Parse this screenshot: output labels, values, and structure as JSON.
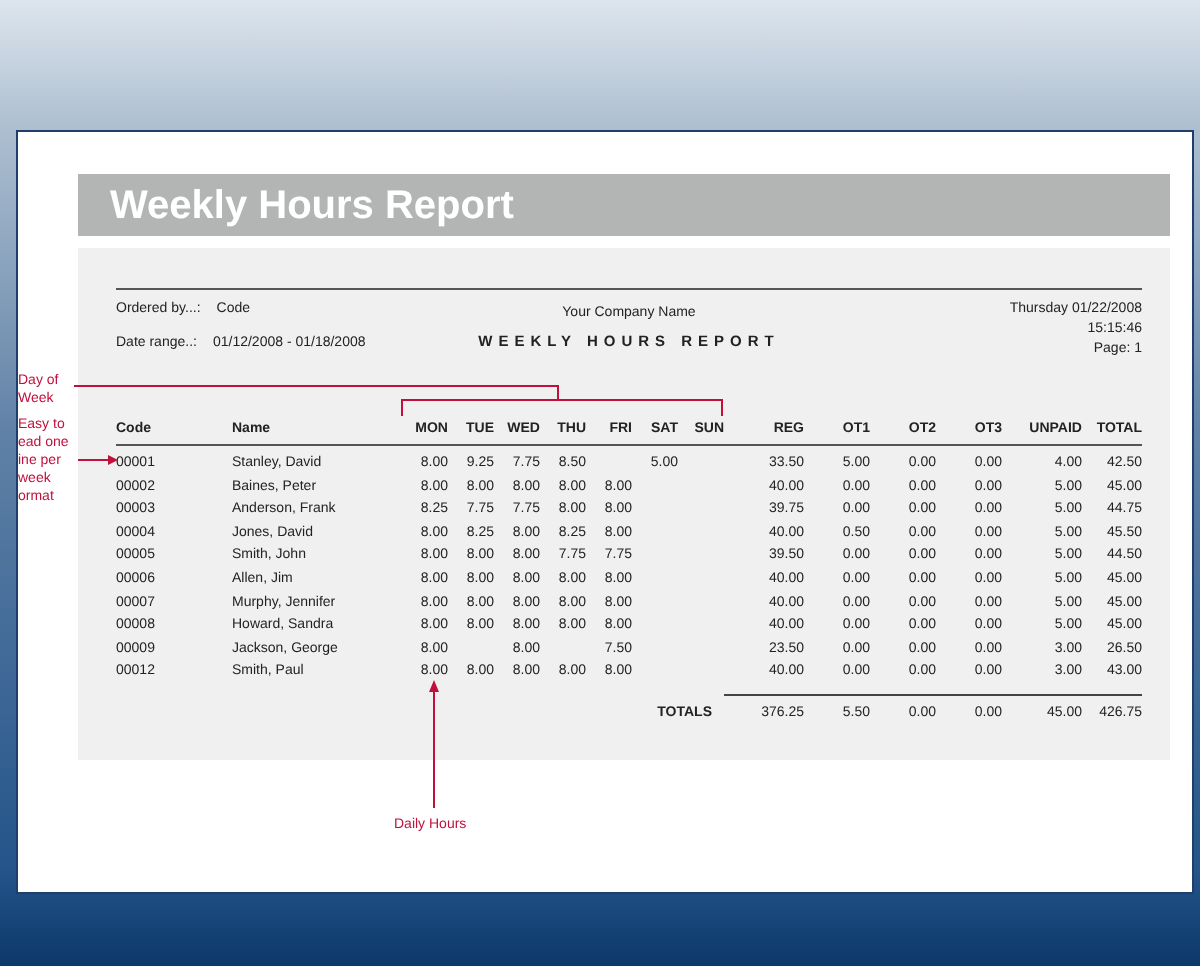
{
  "report": {
    "title": "Weekly Hours Report",
    "ordered_by": {
      "label": "Ordered by...:",
      "value": "Code"
    },
    "date_range": {
      "label": "Date range..:",
      "value": "01/12/2008 - 01/18/2008"
    },
    "company": "Your Company Name",
    "heading": "WEEKLY HOURS REPORT",
    "date": "Thursday  01/22/2008",
    "time": "15:15:46",
    "page": "Page: 1",
    "columns": [
      "Code",
      "Name",
      "MON",
      "TUE",
      "WED",
      "THU",
      "FRI",
      "SAT",
      "SUN",
      "REG",
      "OT1",
      "OT2",
      "OT3",
      "UNPAID",
      "TOTAL"
    ],
    "rows": [
      [
        "00001",
        "Stanley, David",
        "8.00",
        "9.25",
        "7.75",
        "8.50",
        null,
        "5.00",
        null,
        "33.50",
        "5.00",
        "0.00",
        "0.00",
        "4.00",
        "42.50"
      ],
      [
        "00002",
        "Baines, Peter",
        "8.00",
        "8.00",
        "8.00",
        "8.00",
        "8.00",
        null,
        null,
        "40.00",
        "0.00",
        "0.00",
        "0.00",
        "5.00",
        "45.00"
      ],
      [
        "00003",
        "Anderson, Frank",
        "8.25",
        "7.75",
        "7.75",
        "8.00",
        "8.00",
        null,
        null,
        "39.75",
        "0.00",
        "0.00",
        "0.00",
        "5.00",
        "44.75"
      ],
      [
        "00004",
        "Jones, David",
        "8.00",
        "8.25",
        "8.00",
        "8.25",
        "8.00",
        null,
        null,
        "40.00",
        "0.50",
        "0.00",
        "0.00",
        "5.00",
        "45.50"
      ],
      [
        "00005",
        "Smith, John",
        "8.00",
        "8.00",
        "8.00",
        "7.75",
        "7.75",
        null,
        null,
        "39.50",
        "0.00",
        "0.00",
        "0.00",
        "5.00",
        "44.50"
      ],
      [
        "00006",
        "Allen, Jim",
        "8.00",
        "8.00",
        "8.00",
        "8.00",
        "8.00",
        null,
        null,
        "40.00",
        "0.00",
        "0.00",
        "0.00",
        "5.00",
        "45.00"
      ],
      [
        "00007",
        "Murphy, Jennifer",
        "8.00",
        "8.00",
        "8.00",
        "8.00",
        "8.00",
        null,
        null,
        "40.00",
        "0.00",
        "0.00",
        "0.00",
        "5.00",
        "45.00"
      ],
      [
        "00008",
        "Howard, Sandra",
        "8.00",
        "8.00",
        "8.00",
        "8.00",
        "8.00",
        null,
        null,
        "40.00",
        "0.00",
        "0.00",
        "0.00",
        "5.00",
        "45.00"
      ],
      [
        "00009",
        "Jackson, George",
        "8.00",
        null,
        "8.00",
        null,
        "7.50",
        null,
        null,
        "23.50",
        "0.00",
        "0.00",
        "0.00",
        "3.00",
        "26.50"
      ],
      [
        "00012",
        "Smith, Paul",
        "8.00",
        "8.00",
        "8.00",
        "8.00",
        "8.00",
        null,
        null,
        "40.00",
        "0.00",
        "0.00",
        "0.00",
        "3.00",
        "43.00"
      ]
    ],
    "totals": {
      "label": "TOTALS",
      "values": [
        "376.25",
        "5.50",
        "0.00",
        "0.00",
        "45.00",
        "426.75"
      ]
    }
  },
  "annotations": [
    {
      "kind": "bracket",
      "lines": [
        "Day of",
        "Week"
      ]
    },
    {
      "kind": "row-pointer",
      "lines": [
        "Easy to",
        "ead one",
        "ine per",
        "week",
        "ormat"
      ]
    },
    {
      "kind": "up-arrow",
      "lines": [
        "Daily Hours"
      ]
    }
  ]
}
